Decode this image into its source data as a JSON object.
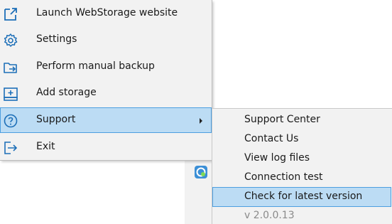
{
  "context_menu": {
    "items": [
      {
        "label": "Launch WebStorage website",
        "icon": "external-link-icon"
      },
      {
        "label": "Settings",
        "icon": "gear-icon"
      },
      {
        "label": "Perform manual backup",
        "icon": "folder-arrow-icon"
      },
      {
        "label": "Add storage",
        "icon": "add-storage-icon"
      },
      {
        "label": "Support",
        "icon": "help-circle-icon",
        "selected": true,
        "has_submenu": true
      },
      {
        "label": "Exit",
        "icon": "exit-icon"
      }
    ]
  },
  "support_submenu": {
    "items": [
      {
        "label": "Support Center"
      },
      {
        "label": "Contact Us"
      },
      {
        "label": "View log files"
      },
      {
        "label": "Connection test"
      },
      {
        "label": "Check for latest version",
        "selected": true
      },
      {
        "label": "v 2.0.0.13",
        "disabled": true
      }
    ]
  },
  "colors": {
    "menu_background": "#f2f2f2",
    "selection_fill": "#bcdcf4",
    "selection_border": "#4d9fe0",
    "icon_blue": "#1d6fb8"
  }
}
